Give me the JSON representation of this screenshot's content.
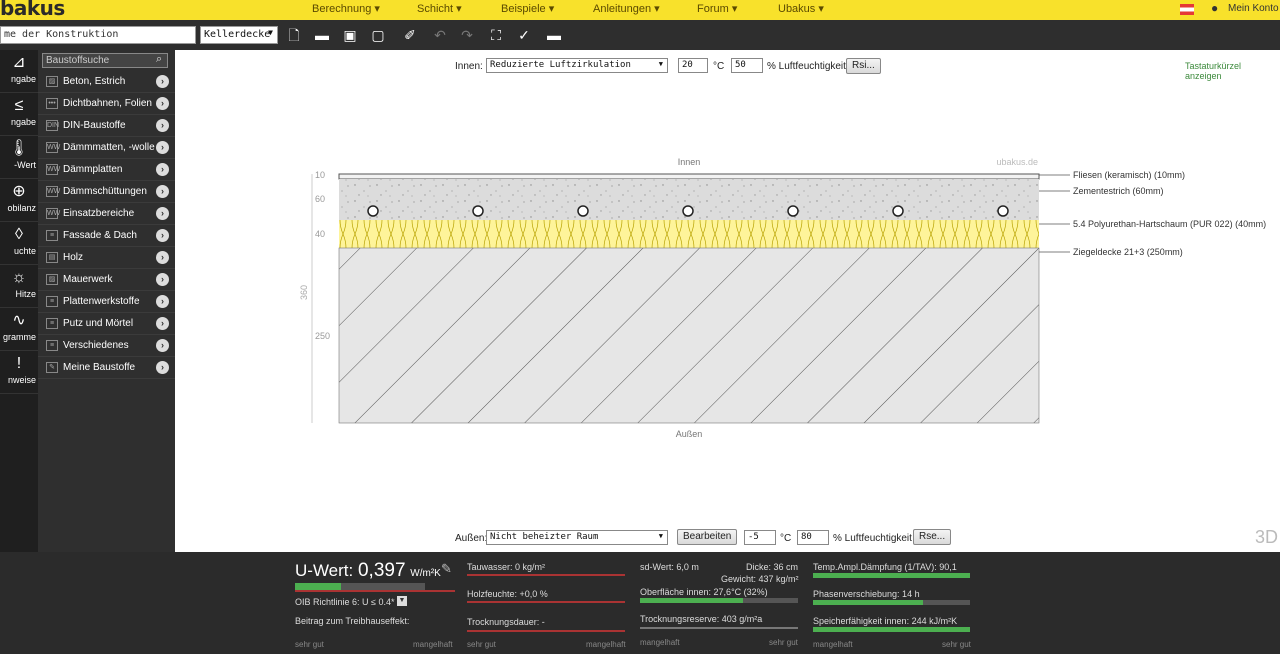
{
  "app": {
    "logo": "bakus"
  },
  "nav": [
    "Berechnung ▾",
    "Schicht ▾",
    "Beispiele ▾",
    "Anleitungen ▾",
    "Forum ▾",
    "Ubakus ▾"
  ],
  "account": "Mein Konto",
  "toolbar": {
    "project_placeholder": "me der Konstruktion",
    "type_value": "Kellerdecke",
    "icons": [
      "new-document-icon",
      "open-folder-icon",
      "save-icon",
      "pdf-icon",
      "edit-icon",
      "undo-icon",
      "redo-icon",
      "fullscreen-icon",
      "tools-icon",
      "comment-icon"
    ]
  },
  "leftnav": [
    {
      "label": "ngabe",
      "icon": "⊿"
    },
    {
      "label": "ngabe",
      "icon": "≤"
    },
    {
      "label": "-Wert",
      "icon": "🌡"
    },
    {
      "label": "obilanz",
      "icon": "⊕"
    },
    {
      "label": "uchte",
      "icon": "◊"
    },
    {
      "label": "Hitze",
      "icon": "☼"
    },
    {
      "label": "gramme",
      "icon": "∿"
    },
    {
      "label": "nweise",
      "icon": "!"
    }
  ],
  "materials": {
    "search_placeholder": "Baustoffsuche",
    "items": [
      {
        "label": "Beton, Estrich",
        "icon": "▨"
      },
      {
        "label": "Dichtbahnen, Folien",
        "icon": "•••"
      },
      {
        "label": "DIN-Baustoffe",
        "icon": "DIN"
      },
      {
        "label": "Dämmmatten, -wolle",
        "icon": "WW"
      },
      {
        "label": "Dämmplatten",
        "icon": "WW"
      },
      {
        "label": "Dämmschüttungen",
        "icon": "WW"
      },
      {
        "label": "Einsatzbereiche",
        "icon": "WW"
      },
      {
        "label": "Fassade & Dach",
        "icon": "≡"
      },
      {
        "label": "Holz",
        "icon": "▤"
      },
      {
        "label": "Mauerwerk",
        "icon": "▨"
      },
      {
        "label": "Plattenwerkstoffe",
        "icon": "≡"
      },
      {
        "label": "Putz und Mörtel",
        "icon": "≡"
      },
      {
        "label": "Verschiedenes",
        "icon": "≡"
      },
      {
        "label": "Meine Baustoffe",
        "icon": "✎"
      }
    ]
  },
  "inner": {
    "label": "Innen:",
    "room": "Reduzierte Luftzirkulation",
    "temp": "20",
    "temp_unit": "°C",
    "humidity": "50",
    "humidity_unit": "% Luftfeuchtigkeit",
    "rsi_button": "Rsi..."
  },
  "shortcuts_link": "Tastaturkürzel anzeigen",
  "outer": {
    "label": "Außen:",
    "room": "Nicht beheizter Raum",
    "edit_button": "Bearbeiten",
    "temp": "-5",
    "temp_unit": "°C",
    "humidity": "80",
    "humidity_unit": "% Luftfeuchtigkeit",
    "rse_button": "Rse..."
  },
  "view3d": "3D",
  "diagram": {
    "top_label": "Innen",
    "bottom_label": "Außen",
    "watermark": "ubakus.de",
    "total_thickness": "360",
    "layers": [
      {
        "thickness": "10",
        "label": "Fliesen (keramisch) (10mm)"
      },
      {
        "thickness": "60",
        "label": "Zementestrich (60mm)"
      },
      {
        "thickness": "40",
        "label": "5.4 Polyurethan-Hartschaum (PUR 022) (40mm)"
      },
      {
        "thickness": "250",
        "label": "Ziegeldecke 21+3 (250mm)"
      }
    ]
  },
  "results": {
    "uvalue_label": "U-Wert:",
    "uvalue": "0,397",
    "uvalue_unit": "W/m²K",
    "oib": "OIB Richtlinie 6: U ≤ 0.4*",
    "greenhouse": "Beitrag zum Treibhauseffekt:",
    "scale_good": "sehr gut",
    "scale_bad": "mangelhaft",
    "tauwasser": "Tauwasser: 0 kg/m²",
    "holzfeuchte": "Holzfeuchte: +0,0 %",
    "trocknungsdauer": "Trocknungsdauer: -",
    "sd_wert": "sd-Wert: 6,0 m",
    "dicke": "Dicke: 36 cm",
    "gewicht": "Gewicht: 437 kg/m²",
    "oberflaeche": "Oberfläche innen: 27,6°C (32%)",
    "trocknungsreserve": "Trocknungsreserve: 403 g/m²a",
    "temp_ampl": "Temp.Ampl.Dämpfung (1/TAV): 90,1",
    "phasen": "Phasenverschiebung: 14 h",
    "speicher": "Speicherfähigkeit innen: 244 kJ/m²K",
    "uvalue_fill": 0.35,
    "oberflaeche_fill": 0.65,
    "temp_ampl_fill": 1.0,
    "phasen_fill": 0.7,
    "speicher_fill": 1.0
  }
}
